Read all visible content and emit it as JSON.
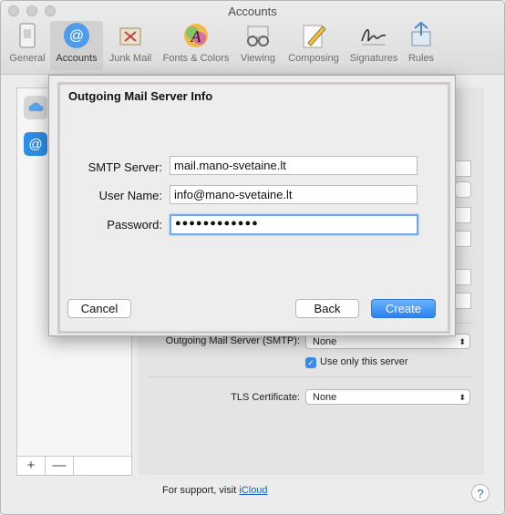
{
  "window": {
    "title": "Accounts"
  },
  "toolbar": {
    "items": [
      {
        "label": "General",
        "icon": "general-icon"
      },
      {
        "label": "Accounts",
        "icon": "accounts-at-icon"
      },
      {
        "label": "Junk Mail",
        "icon": "junk-mail-icon"
      },
      {
        "label": "Fonts & Colors",
        "icon": "fonts-colors-icon"
      },
      {
        "label": "Viewing",
        "icon": "viewing-glasses-icon"
      },
      {
        "label": "Composing",
        "icon": "composing-pencil-icon"
      },
      {
        "label": "Signatures",
        "icon": "signature-icon"
      },
      {
        "label": "Rules",
        "icon": "rules-icon"
      }
    ]
  },
  "sidebar": {
    "add_label": "+",
    "remove_label": "—"
  },
  "panel": {
    "smtp_label": "Outgoing Mail Server (SMTP):",
    "smtp_value": "None",
    "only_server_label": "Use only this server",
    "tls_label": "TLS Certificate:",
    "tls_value": "None"
  },
  "support": {
    "prefix": "For support, visit ",
    "link": "iCloud"
  },
  "help_label": "?",
  "sheet": {
    "title": "Outgoing Mail Server Info",
    "smtp_server_label": "SMTP Server:",
    "smtp_server_value": "mail.mano-svetaine.lt",
    "user_name_label": "User Name:",
    "user_name_value": "info@mano-svetaine.lt",
    "password_label": "Password:",
    "password_value": "●●●●●●●●●●●●",
    "cancel_label": "Cancel",
    "back_label": "Back",
    "create_label": "Create"
  },
  "colors": {
    "accent": "#2a82f0",
    "checkbox": "#3d88ec",
    "link": "#1a5fc6"
  }
}
